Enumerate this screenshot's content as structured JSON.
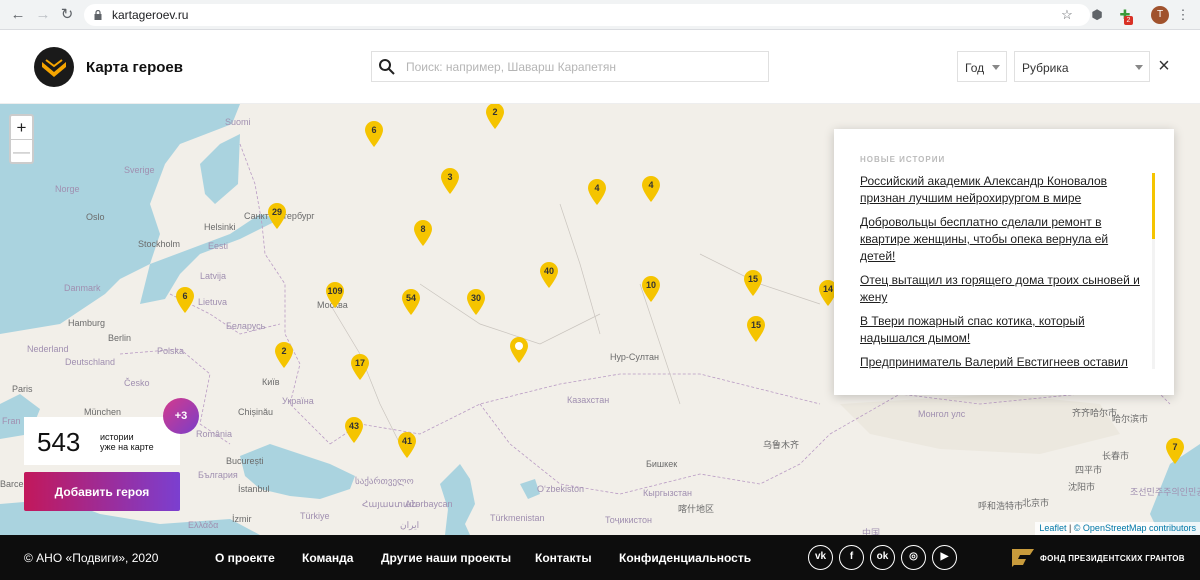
{
  "browser": {
    "url": "kartageroev.ru",
    "avatar_letter": "T",
    "badge_count": "2"
  },
  "header": {
    "title": "Карта героев",
    "search_placeholder": "Поиск: например, Шаварш Карапетян",
    "year_label": "Год",
    "category_label": "Рубрика"
  },
  "map": {
    "zoom_in": "+",
    "zoom_out": "—",
    "places": {
      "suomi": "Suomi",
      "sverige": "Sverige",
      "norge": "Norge",
      "oslo": "Oslo",
      "stockholm": "Stockholm",
      "helsinki": "Helsinki",
      "spb": "Санкт-Петербург",
      "eesti": "Eesti",
      "latvija": "Latvija",
      "lietuva": "Lietuva",
      "danmark": "Danmark",
      "hamburg": "Hamburg",
      "berlin": "Berlin",
      "nederland": "Nederland",
      "deutschland": "Deutschland",
      "polska": "Polska",
      "belarus": "Беларусь",
      "moskva": "Москва",
      "paris": "Paris",
      "cesko": "Česko",
      "kyiv": "Київ",
      "ukraina": "Україна",
      "munchen": "München",
      "chisinau": "Chișinău",
      "romania": "România",
      "bucuresti": "București",
      "bulgaria": "България",
      "istanbul": "İstanbul",
      "turkiye": "Türkiye",
      "izmir": "İzmir",
      "hellas": "Ελλάδα",
      "barcelona": "Barcel",
      "france": "Fran",
      "georgia": "საქართველო",
      "armenia": "Հայաստան",
      "azerbaycan": "Azərbaycan",
      "turkmenistan": "Türkmenistan",
      "uzbekiston": "O‘zbekiston",
      "kazakhstan": "Казахстан",
      "nursultan": "Нур-Султан",
      "kyrgyzstan": "Кыргызстан",
      "tajikistan": "Тоҷикистон",
      "bishkek": "Бишкек",
      "urumqi": "乌鲁木齐",
      "xinjiang_city": "喀什地区",
      "mongolia": "Монгол улс",
      "china": "中国",
      "qiqihar": "齐齐哈尔市",
      "harbin": "哈尔滨市",
      "changchun": "长春市",
      "shenyang": "沈阳市",
      "beijing": "北京市",
      "huhhot": "呼和浩特市",
      "korea": "조선민주주의인민공화국",
      "sichuanchuan": "四平市",
      "iran": "ایران",
      "kazakhstan_s": "Қаз"
    },
    "markers": [
      {
        "count": "2"
      },
      {
        "count": "6"
      },
      {
        "count": "3"
      },
      {
        "count": "4"
      },
      {
        "count": "4"
      },
      {
        "count": "29"
      },
      {
        "count": "8"
      },
      {
        "count": "40"
      },
      {
        "count": "15"
      },
      {
        "count": "14"
      },
      {
        "count": "10"
      },
      {
        "count": "6"
      },
      {
        "count": "109"
      },
      {
        "count": "54"
      },
      {
        "count": "30"
      },
      {
        "count": "15"
      },
      {
        "count": "2"
      },
      {
        "count": "17"
      },
      {
        "count": "43"
      },
      {
        "count": "41"
      },
      {
        "count": "7"
      },
      {
        "count": ""
      }
    ],
    "attribution_leaflet": "Leaflet",
    "attribution_osm": "© OpenStreetMap contributors"
  },
  "news": {
    "heading": "НОВЫЕ ИСТОРИИ",
    "items": [
      "Российский академик Александр Коновалов признан лучшим нейрохирургом в мире",
      "Добровольцы бесплатно сделали ремонт в квартире женщины, чтобы опека вернула ей детей!",
      "Отец вытащил из горящего дома троих сыновей и жену",
      "В Твери пожарный спас котика, который надышался дымом!",
      "Предприниматель Валерий Евстигнеев оставил"
    ]
  },
  "counter": {
    "number": "543",
    "caption_line1": "истории",
    "caption_line2": "уже на карте",
    "more": "+3"
  },
  "add_button": "Добавить героя",
  "footer": {
    "copyright": "© АНО «Подвиги», 2020",
    "links": [
      "О проекте",
      "Команда",
      "Другие наши проекты",
      "Контакты",
      "Конфиденциальность"
    ],
    "social": [
      "vk",
      "f",
      "ok",
      "ig",
      "yt"
    ],
    "fund": "ФОНД ПРЕЗИДЕНТСКИХ ГРАНТОВ"
  },
  "colors": {
    "marker": "#f5c400",
    "button_start": "#c2185b",
    "button_end": "#7b3fd0",
    "water": "#aad3df",
    "land": "#f2efe9"
  }
}
